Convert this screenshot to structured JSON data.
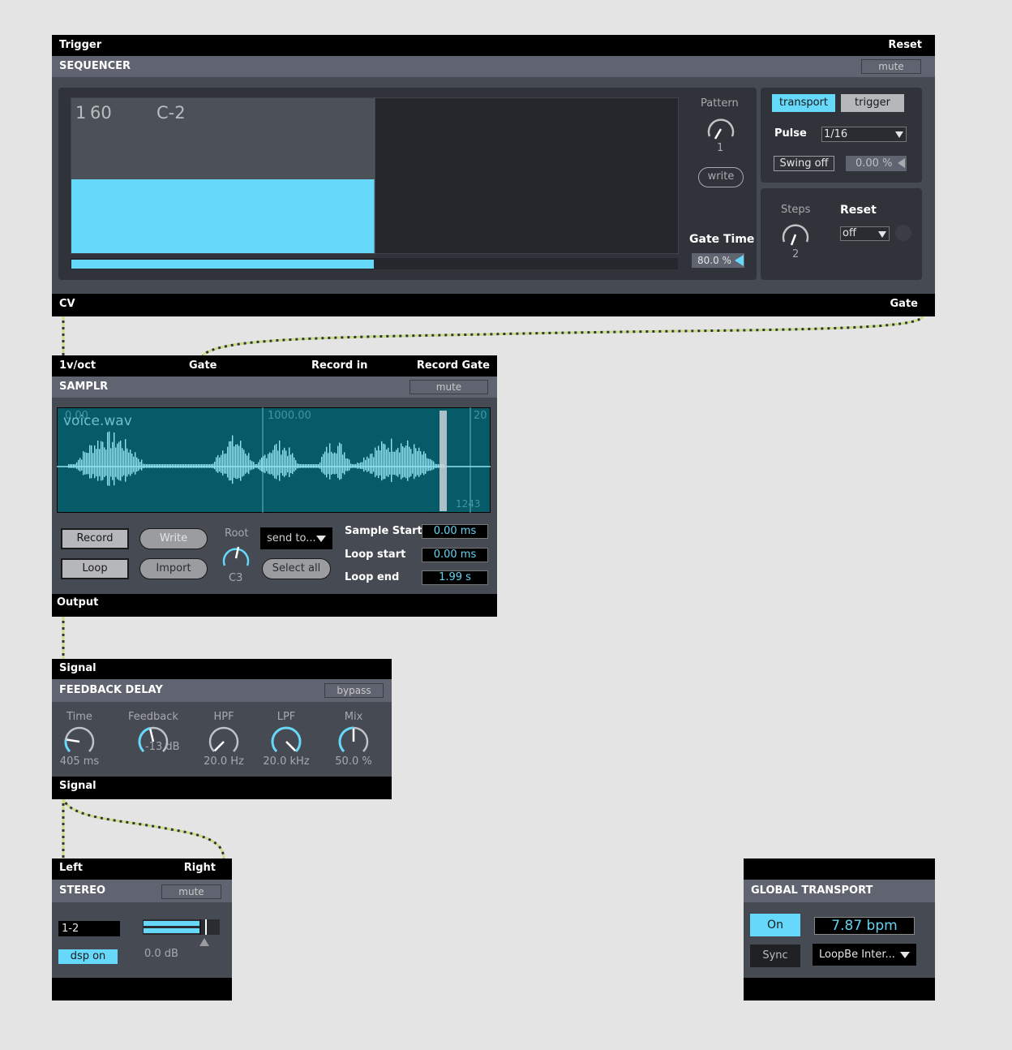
{
  "colors": {
    "accent": "#66d8fa",
    "background": "#e4e4e4",
    "panel": "#464a52",
    "dark": "#30333a",
    "cable": "#c9df87"
  },
  "sequencer": {
    "ports_top": {
      "left": "Trigger",
      "right": "Reset"
    },
    "title": "SEQUENCER",
    "mute_label": "mute",
    "display_step": "1",
    "display_velocity": "60",
    "display_note": "C-2",
    "pattern_label": "Pattern",
    "pattern_value": "1",
    "write_label": "write",
    "gate_time_label": "Gate Time",
    "gate_time_value": "80.0 %",
    "transport_label": "transport",
    "trigger_label": "trigger",
    "pulse_label": "Pulse",
    "pulse_value": "1/16",
    "swing_label": "Swing off",
    "swing_value": "0.00 %",
    "steps_label": "Steps",
    "steps_value": "2",
    "reset_label": "Reset",
    "reset_value": "off",
    "step_values": [
      0.4,
      0.0
    ],
    "ports_bottom": {
      "left": "CV",
      "right": "Gate"
    }
  },
  "samplr": {
    "ports_top": [
      "1v/oct",
      "Gate",
      "Record in",
      "Record Gate"
    ],
    "title": "SAMPLR",
    "mute_label": "mute",
    "filename": "voice.wav",
    "ruler_start": "0.00",
    "ruler_mid": "1000.00",
    "ruler_end": "20",
    "sample_count": "1243",
    "record_label": "Record",
    "write_label": "Write",
    "loop_label": "Loop",
    "import_label": "Import",
    "root_label": "Root",
    "root_value": "C3",
    "send_to_label": "send to...",
    "select_all_label": "Select all",
    "sample_start_label": "Sample Start",
    "sample_start_value": "0.00 ms",
    "loop_start_label": "Loop start",
    "loop_start_value": "0.00 ms",
    "loop_end_label": "Loop end",
    "loop_end_value": "1.99 s",
    "output_label": "Output"
  },
  "delay": {
    "port_top": "Signal",
    "title": "FEEDBACK DELAY",
    "bypass_label": "bypass",
    "knobs": [
      {
        "label": "Time",
        "value": "405 ms",
        "level": 0.2
      },
      {
        "label": "Feedback",
        "value": "-13 dB",
        "level": 0.45
      },
      {
        "label": "HPF",
        "value": "20.0 Hz",
        "level": 0.0
      },
      {
        "label": "LPF",
        "value": "20.0 kHz",
        "level": 1.0
      },
      {
        "label": "Mix",
        "value": "50.0 %",
        "level": 0.5
      }
    ],
    "port_bottom": "Signal"
  },
  "stereo": {
    "ports_top": {
      "left": "Left",
      "right": "Right"
    },
    "title": "STEREO",
    "mute_label": "mute",
    "channel_value": "1-2",
    "dsp_label": "dsp on",
    "gain_value": "0.0 dB"
  },
  "global_transport": {
    "title": "GLOBAL TRANSPORT",
    "on_label": "On",
    "bpm_value": "7.87 bpm",
    "sync_label": "Sync",
    "midi_device": "LoopBe Inter..."
  }
}
